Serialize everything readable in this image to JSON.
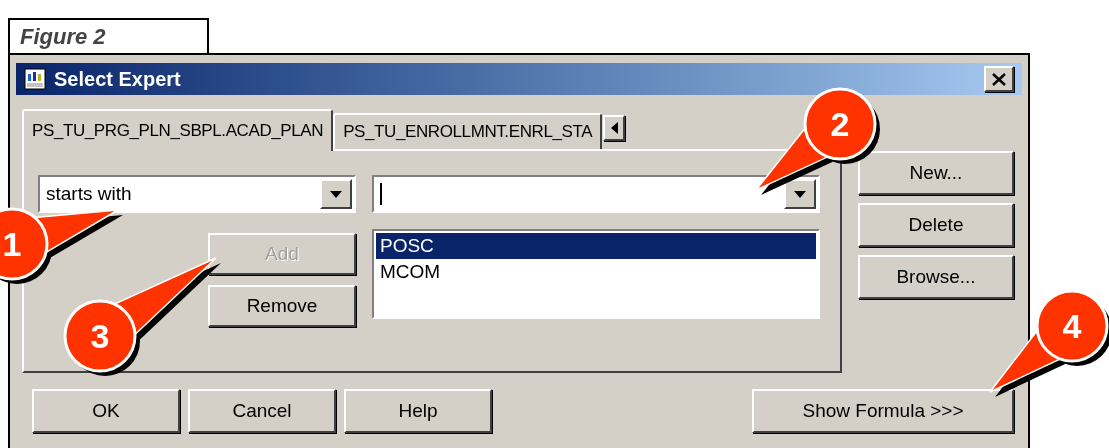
{
  "figure_caption": "Figure 2",
  "window": {
    "title": "Select Expert"
  },
  "tabs": [
    {
      "label": "PS_TU_PRG_PLN_SBPL.ACAD_PLAN",
      "selected": true
    },
    {
      "label": "PS_TU_ENROLLMNT.ENRL_STA",
      "selected": false
    }
  ],
  "operator_dropdown": {
    "value": "starts with"
  },
  "list_buttons": [
    {
      "label": "Add",
      "disabled": true
    },
    {
      "label": "Remove",
      "disabled": false
    }
  ],
  "values_list": [
    {
      "label": "POSC",
      "selected": true
    },
    {
      "label": "MCOM",
      "selected": false
    }
  ],
  "side_buttons": [
    "New...",
    "Delete",
    "Browse..."
  ],
  "footer_buttons": [
    "OK",
    "Cancel",
    "Help"
  ],
  "formula_button": "Show Formula >>>",
  "callouts": [
    {
      "number": "1"
    },
    {
      "number": "2"
    },
    {
      "number": "3"
    },
    {
      "number": "4"
    }
  ]
}
